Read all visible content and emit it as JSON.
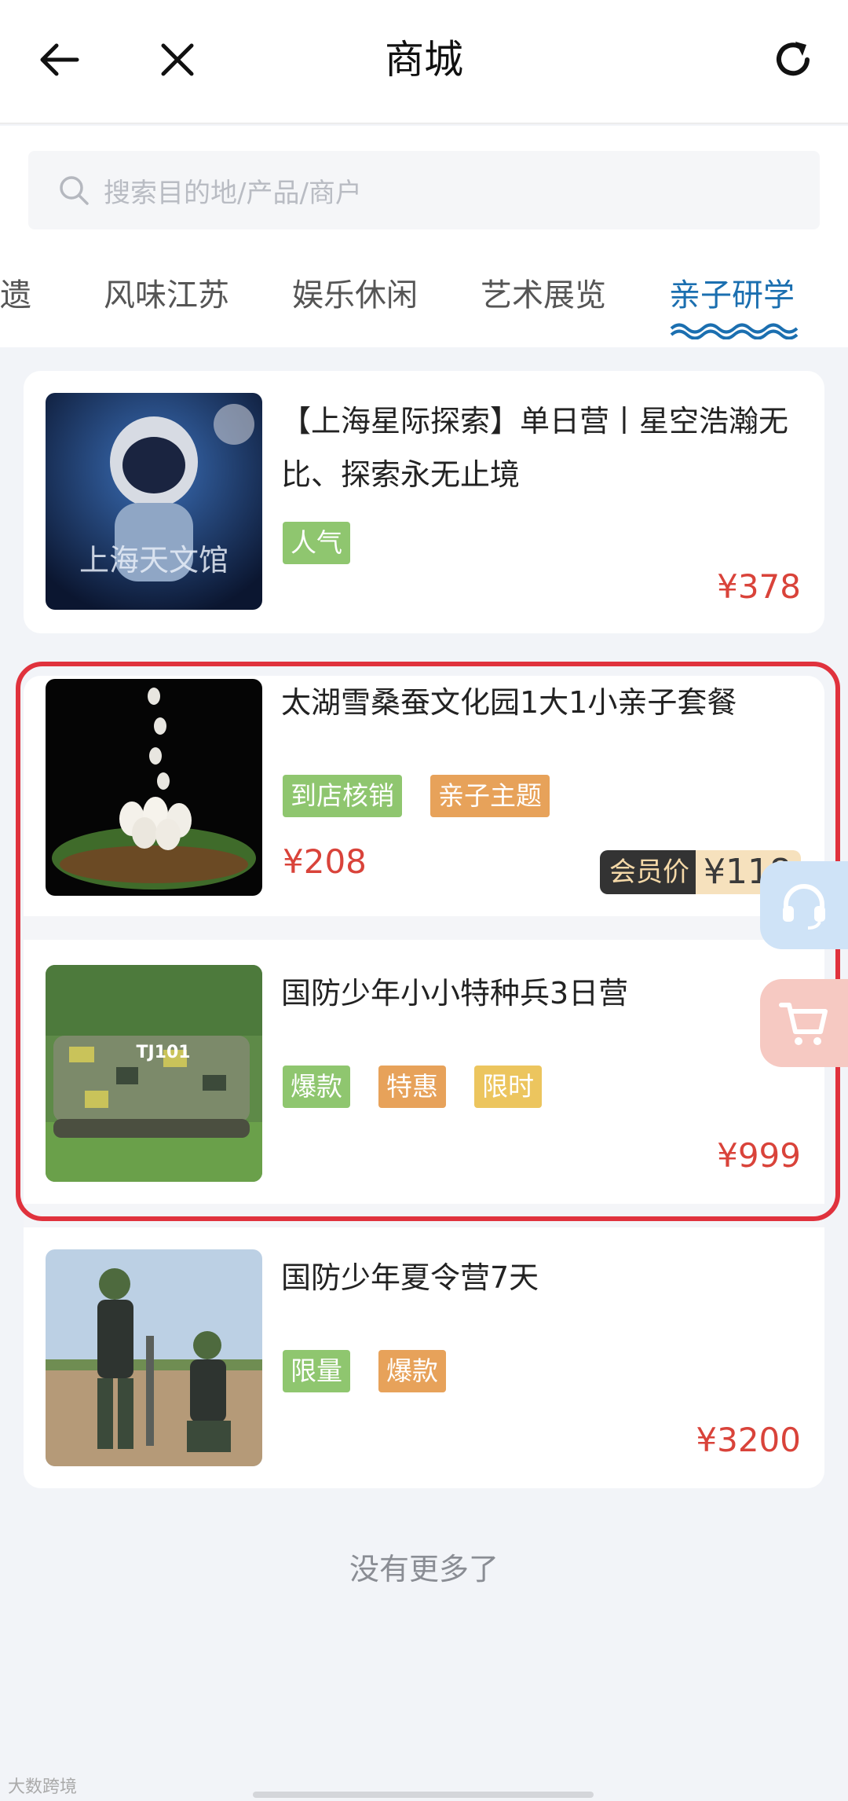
{
  "header": {
    "title": "商城"
  },
  "search": {
    "placeholder": "搜索目的地/产品/商户"
  },
  "tabs": [
    {
      "label": "非遗"
    },
    {
      "label": "风味江苏"
    },
    {
      "label": "娱乐休闲"
    },
    {
      "label": "艺术展览"
    },
    {
      "label": "亲子研学",
      "active": true
    }
  ],
  "products": [
    {
      "title": "【上海星际探索】单日营丨星空浩瀚无比、探索永无止境",
      "tags": [
        "人气"
      ],
      "price": "¥378",
      "thumb_text": "上海天文馆"
    },
    {
      "title": "太湖雪桑蚕文化园1大1小亲子套餐",
      "tags": [
        "到店核销",
        "亲子主题"
      ],
      "price": "¥208",
      "member_label": "会员价",
      "member_price": "¥118"
    },
    {
      "title": "国防少年小小特种兵3日营",
      "tags": [
        "爆款",
        "特惠",
        "限时"
      ],
      "price": "¥999",
      "thumb_text": "TJ101"
    },
    {
      "title": "国防少年夏令营7天",
      "tags": [
        "限量",
        "爆款"
      ],
      "price": "¥3200"
    }
  ],
  "footer": {
    "no_more": "没有更多了"
  },
  "watermark": "大数跨境",
  "colors": {
    "accent": "#1b6fb0",
    "price": "#d9433a",
    "highlight": "#e0323d"
  },
  "icons": [
    "arrow-left-icon",
    "close-icon",
    "refresh-icon",
    "search-icon",
    "headset-icon",
    "cart-icon"
  ]
}
